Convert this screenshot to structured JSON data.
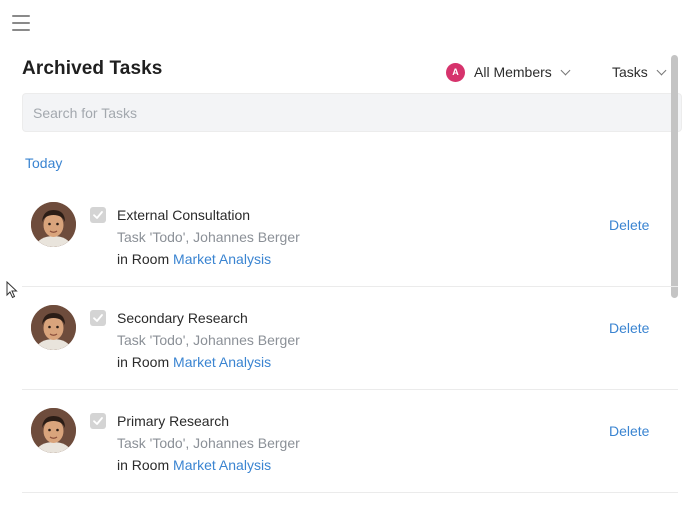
{
  "header": {
    "menu_icon": "hamburger-icon",
    "title": "Archived Tasks",
    "members_filter": {
      "avatar_letter": "A",
      "avatar_color": "#d6336c",
      "label": "All Members"
    },
    "type_filter": {
      "label": "Tasks"
    }
  },
  "search": {
    "placeholder": "Search for Tasks",
    "value": ""
  },
  "groups": [
    {
      "label": "Today",
      "tasks": [
        {
          "name": "External Consultation",
          "meta": "Task 'Todo', Johannes Berger",
          "room_prefix": "in Room",
          "room": "Market Analysis",
          "delete_label": "Delete"
        },
        {
          "name": "Secondary Research",
          "meta": "Task 'Todo', Johannes Berger",
          "room_prefix": "in Room",
          "room": "Market Analysis",
          "delete_label": "Delete"
        },
        {
          "name": "Primary Research",
          "meta": "Task 'Todo', Johannes Berger",
          "room_prefix": "in Room",
          "room": "Market Analysis",
          "delete_label": "Delete"
        }
      ]
    }
  ],
  "colors": {
    "accent": "#3a84d1",
    "muted_text": "#8b9097",
    "checkbox": "#d4d4d4"
  }
}
